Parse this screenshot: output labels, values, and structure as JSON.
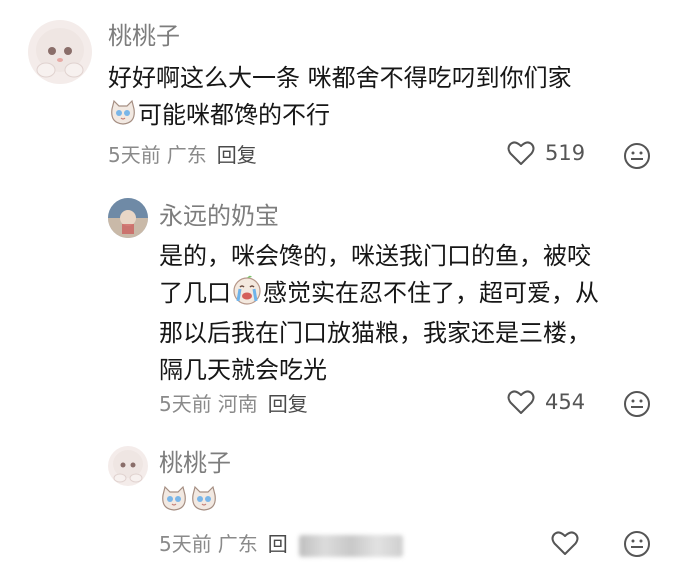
{
  "comments": [
    {
      "name": "桃桃子",
      "text_before_emoji": "好好啊这么大一条 咪都舍不得吃叼到你们家",
      "text_after_emoji": "可能咪都馋的不行",
      "emoji_icon": "cat-crying-emoji",
      "time": "5天前",
      "location": "广东",
      "reply_label": "回复",
      "likes": "519"
    },
    {
      "name": "永远的奶宝",
      "lines": [
        "是的，咪会馋的，咪送我门口的鱼，被咬",
        "了几口",
        "感觉实在忍不住了，超可爱，从",
        "那以后我在门口放猫粮，我家还是三楼，",
        "隔几天就会吃光"
      ],
      "emoji_icon": "loudly-crying-emoji",
      "time": "5天前",
      "location": "河南",
      "reply_label": "回复",
      "likes": "454"
    },
    {
      "name": "桃桃子",
      "emoji_icons": [
        "cat-crying-emoji",
        "cat-crying-emoji"
      ],
      "time": "5天前",
      "location": "广东",
      "reply_label_partial": "回"
    }
  ],
  "colors": {
    "name": "#7d7d7d",
    "meta": "#8a8a8a",
    "text": "#161616",
    "icon": "#555555"
  },
  "icons": {
    "like": "heart-outline-icon",
    "emoji_react": "smile-face-icon"
  }
}
